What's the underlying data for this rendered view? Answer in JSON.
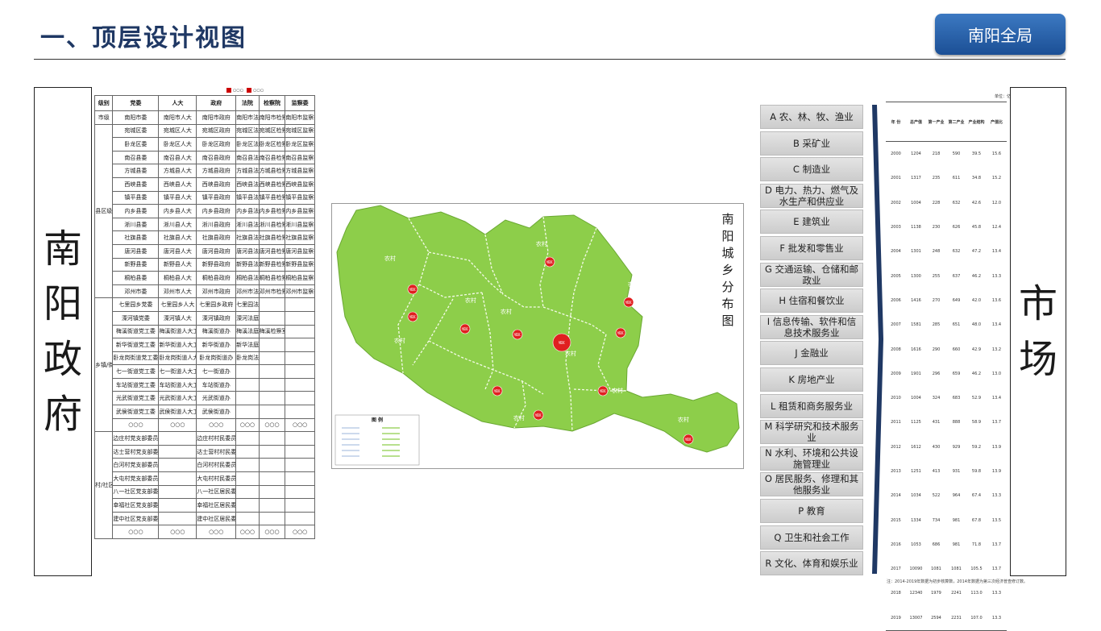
{
  "header": {
    "title": "一、顶层设计视图",
    "nav_button": "南阳全局"
  },
  "left_label": [
    "南",
    "阳",
    "政",
    "府"
  ],
  "right_label": [
    "市",
    "场"
  ],
  "org_table": {
    "legend": [
      "○○○",
      "○○○"
    ],
    "columns": [
      "级别",
      "党委",
      "人大",
      "政府",
      "法院",
      "检察院",
      "监察委"
    ],
    "sections": [
      {
        "level": "市级",
        "rows": [
          [
            "南阳市委",
            "南阳市人大",
            "南阳市政府",
            "南阳市法院",
            "南阳市检察院",
            "南阳市监察委"
          ]
        ]
      },
      {
        "level": "县区级",
        "rows": [
          [
            "宛城区委",
            "宛城区人大",
            "宛城区政府",
            "宛城区法院",
            "宛城区检察院",
            "宛城区监察委"
          ],
          [
            "卧龙区委",
            "卧龙区人大",
            "卧龙区政府",
            "卧龙区法院",
            "卧龙区检察院",
            "卧龙区监察委"
          ],
          [
            "南召县委",
            "南召县人大",
            "南召县政府",
            "南召县法院",
            "南召县检察院",
            "南召县监察委"
          ],
          [
            "方城县委",
            "方城县人大",
            "方城县政府",
            "方城县法院",
            "方城县检察院",
            "方城县监察委"
          ],
          [
            "西峡县委",
            "西峡县人大",
            "西峡县政府",
            "西峡县法院",
            "西峡县检察院",
            "西峡县监察委"
          ],
          [
            "镇平县委",
            "镇平县人大",
            "镇平县政府",
            "镇平县法院",
            "镇平县检察院",
            "镇平县监察委"
          ],
          [
            "内乡县委",
            "内乡县人大",
            "内乡县政府",
            "内乡县法院",
            "内乡县检察院",
            "内乡县监察委"
          ],
          [
            "淅川县委",
            "淅川县人大",
            "淅川县政府",
            "淅川县法院",
            "淅川县检察院",
            "淅川县监察委"
          ],
          [
            "社旗县委",
            "社旗县人大",
            "社旗县政府",
            "社旗县法院",
            "社旗县检察院",
            "社旗县监察委"
          ],
          [
            "唐河县委",
            "唐河县人大",
            "唐河县政府",
            "唐河县法院",
            "唐河县检察院",
            "唐河县监察委"
          ],
          [
            "新野县委",
            "新野县人大",
            "新野县政府",
            "新野县法院",
            "新野县检察院",
            "新野县监察委"
          ],
          [
            "桐柏县委",
            "桐柏县人大",
            "桐柏县政府",
            "桐柏县法院",
            "桐柏县检察院",
            "桐柏县监察委"
          ],
          [
            "邓州市委",
            "邓州市人大",
            "邓州市政府",
            "邓州市法院",
            "邓州市检察院",
            "邓州市监察委"
          ]
        ]
      },
      {
        "level": "乡镇/街道",
        "rows": [
          [
            "七里园乡党委",
            "七里园乡人大",
            "七里园乡政府",
            "七里园法庭",
            "",
            ""
          ],
          [
            "溧河镇党委",
            "溧河镇人大",
            "溧河镇政府",
            "溧河法庭",
            "",
            ""
          ],
          [
            "梅溪街道党工委",
            "梅溪街道人大工委",
            "梅溪街道办",
            "梅溪法庭",
            "梅溪检察室",
            ""
          ],
          [
            "新华街道党工委",
            "新华街道人大工委",
            "新华街道办",
            "新华法庭",
            "",
            ""
          ],
          [
            "卧龙岗街道党工委",
            "卧龙岗街道人大工委",
            "卧龙岗街道办",
            "卧龙岗法庭",
            "",
            ""
          ],
          [
            "七一街道党工委",
            "七一街道人大工委",
            "七一街道办",
            "",
            "",
            ""
          ],
          [
            "车站街道党工委",
            "车站街道人大工委",
            "车站街道办",
            "",
            "",
            ""
          ],
          [
            "光武街道党工委",
            "光武街道人大工委",
            "光武街道办",
            "",
            "",
            ""
          ],
          [
            "武侯街道党工委",
            "武侯街道人大工委",
            "武侯街道办",
            "",
            "",
            ""
          ],
          [
            "○○○",
            "○○○",
            "○○○",
            "○○○",
            "○○○",
            "○○○"
          ]
        ]
      },
      {
        "level": "村/社区",
        "rows": [
          [
            "边庄村党支部委员会",
            "",
            "边庄村村民委员会",
            "",
            "",
            ""
          ],
          [
            "达士营村党支部委员会",
            "",
            "达士营村村民委员会",
            "",
            "",
            ""
          ],
          [
            "白河村党支部委员会",
            "",
            "白河村村民委员会",
            "",
            "",
            ""
          ],
          [
            "大屯村党支部委员会",
            "",
            "大屯村村民委员会",
            "",
            "",
            ""
          ],
          [
            "八一社区党支部委员会",
            "",
            "八一社区居民委员会",
            "",
            "",
            ""
          ],
          [
            "幸福社区党支部委员会",
            "",
            "幸福社区居民委员会",
            "",
            "",
            ""
          ],
          [
            "建中社区党支部委员会",
            "",
            "建中社区居民委员会",
            "",
            "",
            ""
          ],
          [
            "○○○",
            "○○○",
            "○○○",
            "○○○",
            "○○○",
            "○○○"
          ]
        ]
      }
    ]
  },
  "map": {
    "title": [
      "南",
      "阳",
      "城",
      "乡",
      "分",
      "布",
      "图"
    ],
    "rural_label": "农村",
    "urban_label": "城区",
    "fill_color": "#8dce4a",
    "urban_color": "#e02020",
    "legend_title": "图 例"
  },
  "industries": [
    "A 农、林、牧、渔业",
    "B 采矿业",
    "C 制造业",
    "D 电力、热力、燃气及水生产和供应业",
    "E 建筑业",
    "F 批发和零售业",
    "G 交通运输、仓储和邮政业",
    "H 住宿和餐饮业",
    "I 信息传输、软件和信息技术服务业",
    "J 金融业",
    "K 房地产业",
    "L 租赁和商务服务业",
    "M 科学研究和技术服务业",
    "N 水利、环境和公共设施管理业",
    "O 居民服务、修理和其他服务业",
    "P 教育",
    "Q 卫生和社会工作",
    "R 文化、体育和娱乐业"
  ],
  "stats": {
    "unit": "单位：亿",
    "headers": [
      "年 份",
      "总产值",
      "第一产业",
      "第二产业",
      "产业结构",
      "产值比"
    ],
    "rows": [
      [
        "2000",
        "1204",
        "218",
        "590",
        "39.5",
        "15.6"
      ],
      [
        "2001",
        "1317",
        "235",
        "611",
        "34.8",
        "15.2"
      ],
      [
        "2002",
        "1004",
        "228",
        "632",
        "42.6",
        "12.0"
      ],
      [
        "2003",
        "1138",
        "230",
        "626",
        "45.8",
        "12.4"
      ],
      [
        "2004",
        "1301",
        "248",
        "632",
        "47.2",
        "13.4"
      ],
      [
        "2005",
        "1300",
        "255",
        "637",
        "46.2",
        "13.3"
      ],
      [
        "2006",
        "1416",
        "270",
        "649",
        "42.0",
        "13.6"
      ],
      [
        "2007",
        "1581",
        "285",
        "651",
        "48.0",
        "13.4"
      ],
      [
        "2008",
        "1616",
        "290",
        "660",
        "42.9",
        "13.2"
      ],
      [
        "2009",
        "1901",
        "296",
        "659",
        "46.2",
        "13.0"
      ],
      [
        "2010",
        "1004",
        "324",
        "683",
        "52.9",
        "13.4"
      ],
      [
        "2011",
        "1125",
        "431",
        "888",
        "58.9",
        "13.7"
      ],
      [
        "2012",
        "1612",
        "430",
        "929",
        "59.2",
        "13.9"
      ],
      [
        "2013",
        "1251",
        "413",
        "931",
        "59.8",
        "13.9"
      ],
      [
        "2014",
        "1034",
        "522",
        "964",
        "67.4",
        "13.3"
      ],
      [
        "2015",
        "1334",
        "734",
        "981",
        "67.8",
        "13.5"
      ],
      [
        "2016",
        "1053",
        "686",
        "981",
        "71.8",
        "13.7"
      ],
      [
        "2017",
        "10090",
        "1081",
        "1081",
        "105.5",
        "13.7"
      ],
      [
        "2018",
        "12340",
        "1979",
        "2241",
        "113.0",
        "13.3"
      ],
      [
        "2019",
        "13007",
        "2594",
        "2231",
        "107.0",
        "13.3"
      ]
    ],
    "note": "注：2014-2019年数据为初步核算数，2014年数据为第三次经济普查修订数。"
  }
}
